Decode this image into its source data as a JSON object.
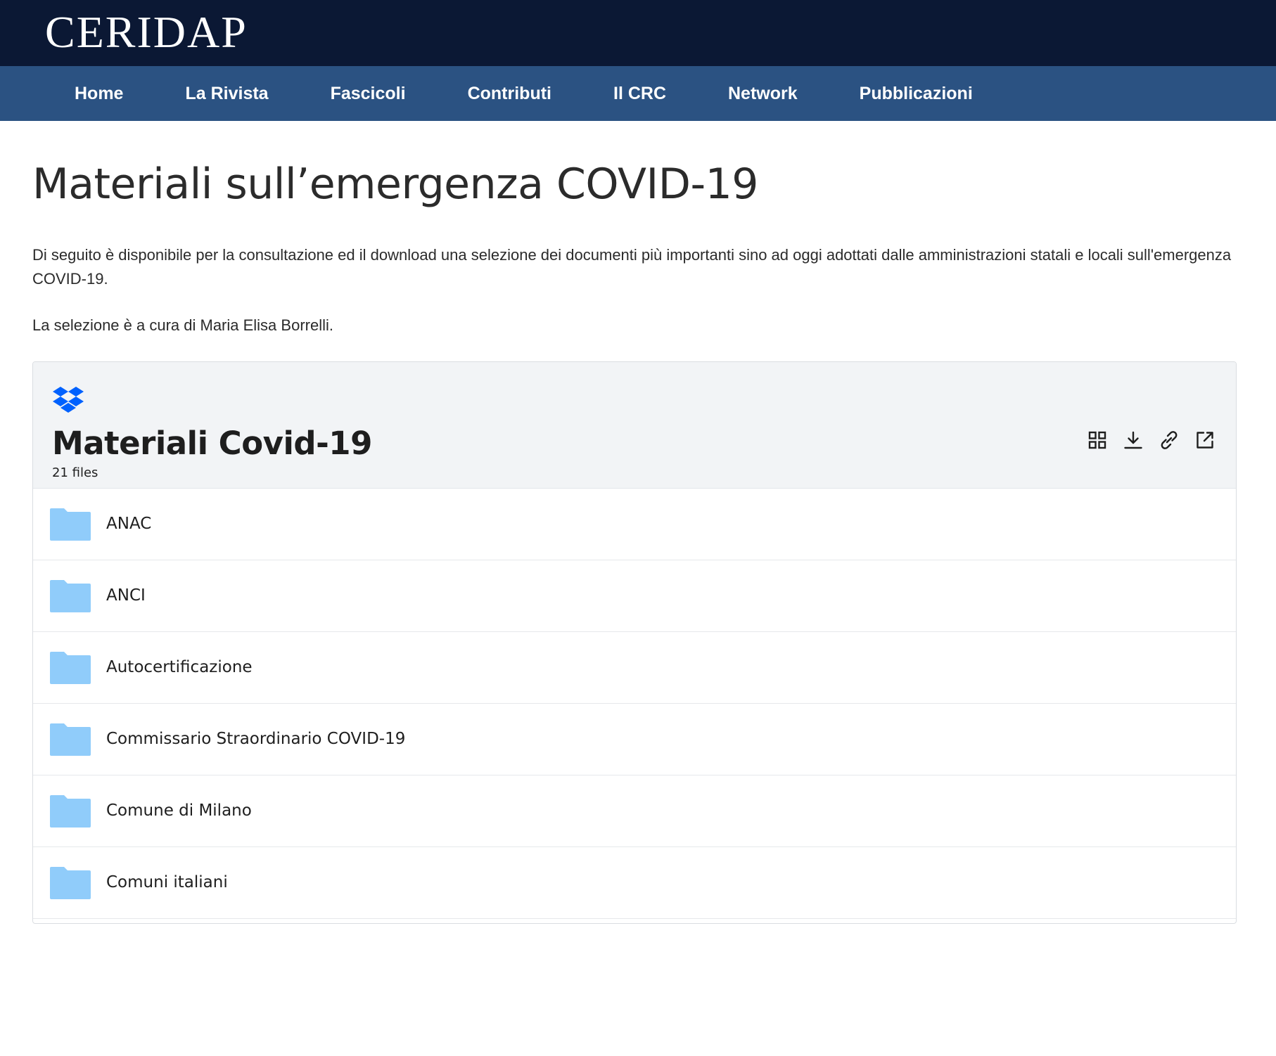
{
  "site": {
    "logo_text": "CERIDAP"
  },
  "nav": {
    "items": [
      {
        "label": "Home"
      },
      {
        "label": "La Rivista"
      },
      {
        "label": "Fascicoli"
      },
      {
        "label": "Contributi"
      },
      {
        "label": "Il CRC"
      },
      {
        "label": "Network"
      },
      {
        "label": "Pubblicazioni"
      }
    ]
  },
  "main": {
    "title": "Materiali sull’emergenza COVID-19",
    "intro": "Di seguito è disponibile per la consultazione ed il download una selezione dei documenti più importanti sino ad oggi adottati dalle amministrazioni statali e locali sull'emergenza COVID-19.",
    "curator": "La selezione è a cura di Maria Elisa Borrelli."
  },
  "embed": {
    "title": "Materiali Covid-19",
    "count": "21 files",
    "actions": [
      "grid-view-icon",
      "download-icon",
      "copy-link-icon",
      "open-external-icon"
    ],
    "files": [
      {
        "name": "ANAC",
        "icon": "folder-icon"
      },
      {
        "name": "ANCI",
        "icon": "folder-icon"
      },
      {
        "name": "Autocertificazione",
        "icon": "folder-icon"
      },
      {
        "name": "Commissario Straordinario COVID-19",
        "icon": "folder-icon"
      },
      {
        "name": "Comune di Milano",
        "icon": "folder-icon"
      },
      {
        "name": "Comuni italiani",
        "icon": "folder-icon"
      }
    ]
  },
  "colors": {
    "topbar": "#0b1834",
    "navbar": "#2b5282",
    "embed_header": "#f2f4f6",
    "folder": "#90ccfa",
    "dropbox_blue": "#0061fe"
  }
}
